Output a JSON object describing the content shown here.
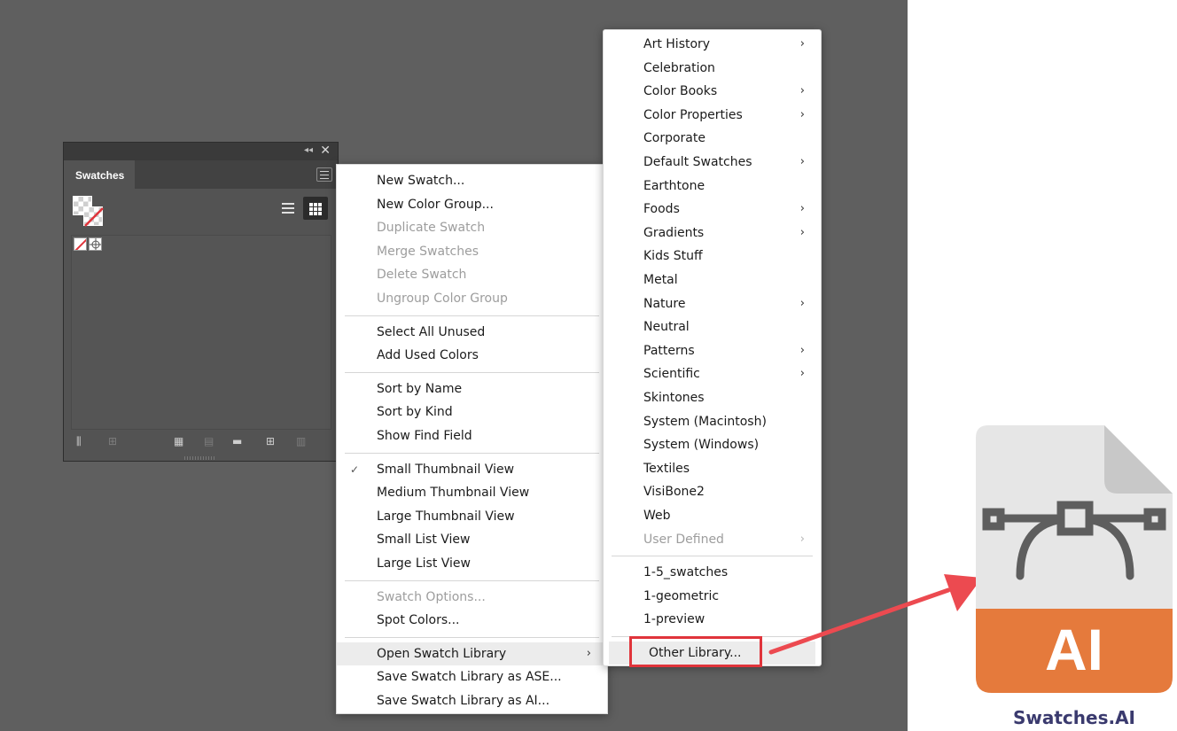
{
  "colors": {
    "workspace_bg": "#5f5f5f",
    "panel_bg": "#535353",
    "highlight_border": "#e0343b",
    "file_badge": "#e57a3c",
    "file_caption": "#3a3a6e"
  },
  "swatches_panel": {
    "tab_label": "Swatches",
    "icons": [
      "collapse-icon",
      "close-icon",
      "panel-menu-icon",
      "list-view-icon",
      "grid-view-icon",
      "swatch-libraries-icon",
      "add-to-library-icon",
      "color-group-icon",
      "swatch-options-icon",
      "new-color-group-icon",
      "new-swatch-icon",
      "delete-swatch-icon"
    ]
  },
  "swatch_menu": {
    "groups": [
      [
        {
          "label": "New Swatch...",
          "disabled": false
        },
        {
          "label": "New Color Group...",
          "disabled": false
        },
        {
          "label": "Duplicate Swatch",
          "disabled": true
        },
        {
          "label": "Merge Swatches",
          "disabled": true
        },
        {
          "label": "Delete Swatch",
          "disabled": true
        },
        {
          "label": "Ungroup Color Group",
          "disabled": true
        }
      ],
      [
        {
          "label": "Select All Unused",
          "disabled": false
        },
        {
          "label": "Add Used Colors",
          "disabled": false
        }
      ],
      [
        {
          "label": "Sort by Name",
          "disabled": false
        },
        {
          "label": "Sort by Kind",
          "disabled": false
        },
        {
          "label": "Show Find Field",
          "disabled": false
        }
      ],
      [
        {
          "label": "Small Thumbnail View",
          "disabled": false,
          "checked": true
        },
        {
          "label": "Medium Thumbnail View",
          "disabled": false
        },
        {
          "label": "Large Thumbnail View",
          "disabled": false
        },
        {
          "label": "Small List View",
          "disabled": false
        },
        {
          "label": "Large List View",
          "disabled": false
        }
      ],
      [
        {
          "label": "Swatch Options...",
          "disabled": true
        },
        {
          "label": "Spot Colors...",
          "disabled": false
        }
      ],
      [
        {
          "label": "Open Swatch Library",
          "disabled": false,
          "submenu": true,
          "hover": true
        },
        {
          "label": "Save Swatch Library as ASE...",
          "disabled": false
        },
        {
          "label": "Save Swatch Library as AI...",
          "disabled": false
        }
      ]
    ]
  },
  "library_menu": {
    "groups": [
      [
        {
          "label": "Art History",
          "submenu": true
        },
        {
          "label": "Celebration"
        },
        {
          "label": "Color Books",
          "submenu": true
        },
        {
          "label": "Color Properties",
          "submenu": true
        },
        {
          "label": "Corporate"
        },
        {
          "label": "Default Swatches",
          "submenu": true
        },
        {
          "label": "Earthtone"
        },
        {
          "label": "Foods",
          "submenu": true
        },
        {
          "label": "Gradients",
          "submenu": true
        },
        {
          "label": "Kids Stuff"
        },
        {
          "label": "Metal"
        },
        {
          "label": "Nature",
          "submenu": true
        },
        {
          "label": "Neutral"
        },
        {
          "label": "Patterns",
          "submenu": true
        },
        {
          "label": "Scientific",
          "submenu": true
        },
        {
          "label": "Skintones"
        },
        {
          "label": "System (Macintosh)"
        },
        {
          "label": "System (Windows)"
        },
        {
          "label": "Textiles"
        },
        {
          "label": "VisiBone2"
        },
        {
          "label": "Web"
        },
        {
          "label": "User Defined",
          "submenu": true,
          "disabled": true
        }
      ],
      [
        {
          "label": "1-5_swatches"
        },
        {
          "label": "1-geometric"
        },
        {
          "label": "1-preview"
        }
      ],
      [
        {
          "label": "Other Library...",
          "hover": true,
          "highlighted": true
        }
      ]
    ]
  },
  "submenu_arrow": "›",
  "check_mark": "✓",
  "file_icon": {
    "badge_text": "AI",
    "caption": "Swatches.AI",
    "glyph": "pen-tool-bezier-icon"
  }
}
